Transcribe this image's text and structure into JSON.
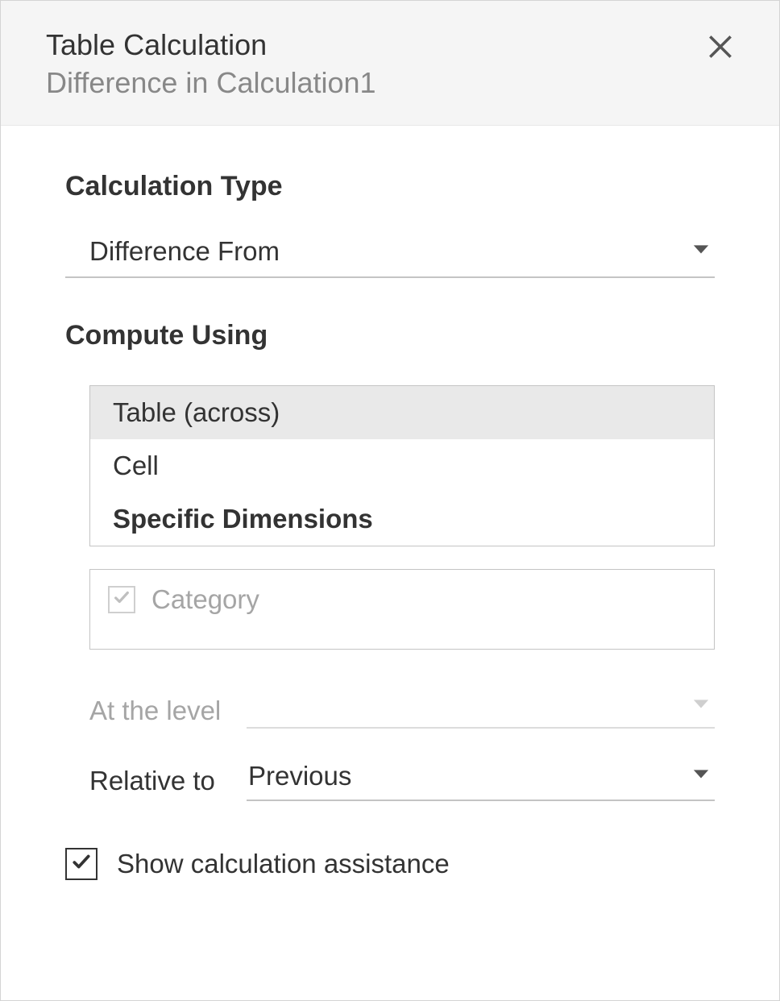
{
  "header": {
    "title": "Table Calculation",
    "subtitle": "Difference in Calculation1"
  },
  "calculation_type": {
    "label": "Calculation Type",
    "selected": "Difference From"
  },
  "compute_using": {
    "label": "Compute Using",
    "options": [
      "Table (across)",
      "Cell",
      "Specific Dimensions"
    ],
    "selected_index": 0
  },
  "dimensions": {
    "items": [
      {
        "label": "Category",
        "checked": true,
        "disabled": true
      }
    ]
  },
  "at_the_level": {
    "label": "At the level",
    "value": "",
    "disabled": true
  },
  "relative_to": {
    "label": "Relative to",
    "value": "Previous",
    "disabled": false
  },
  "show_assistance": {
    "label": "Show calculation assistance",
    "checked": true
  }
}
